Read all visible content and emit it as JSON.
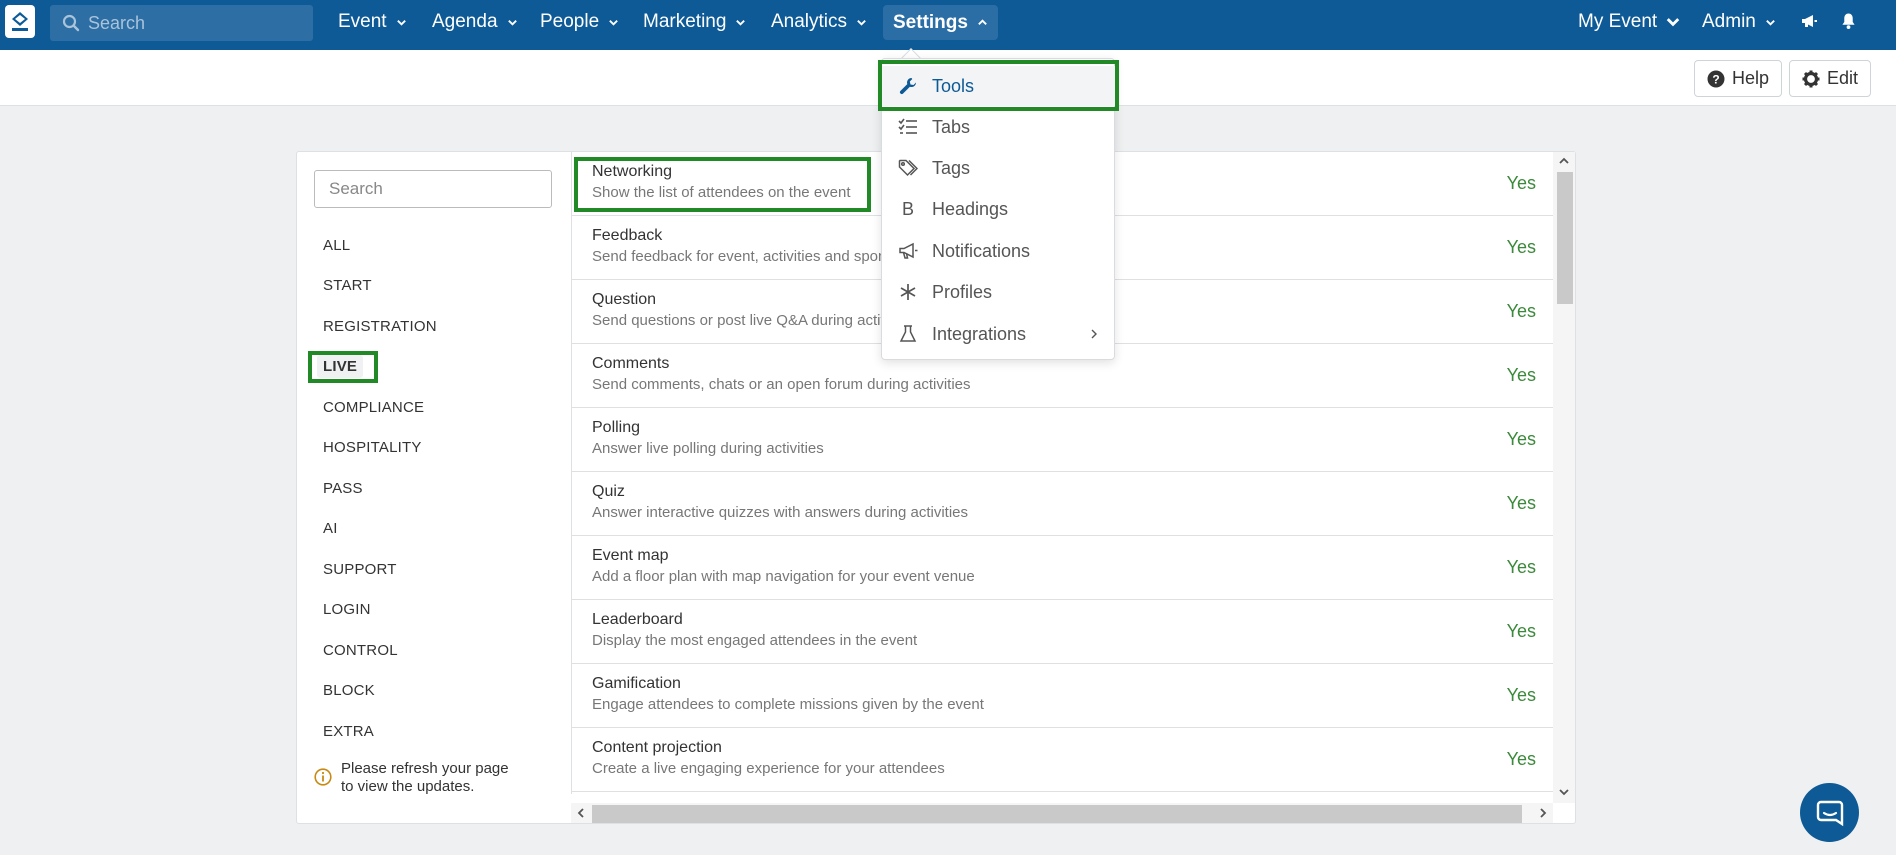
{
  "nav": {
    "search_placeholder": "Search",
    "items": [
      "Event",
      "Agenda",
      "People",
      "Marketing",
      "Analytics",
      "Settings"
    ],
    "right_items": [
      "My Event",
      "Admin"
    ],
    "icons": [
      "megaphone-icon",
      "bell-icon"
    ]
  },
  "header": {
    "help_label": "Help",
    "edit_label": "Edit"
  },
  "sidebar": {
    "search_placeholder": "Search",
    "categories": [
      "ALL",
      "START",
      "REGISTRATION",
      "LIVE",
      "COMPLIANCE",
      "HOSPITALITY",
      "PASS",
      "AI",
      "SUPPORT",
      "LOGIN",
      "CONTROL",
      "BLOCK",
      "EXTRA"
    ],
    "selected": "LIVE",
    "notice": [
      "Please refresh your page",
      "to view the updates."
    ]
  },
  "features": [
    {
      "title": "Networking",
      "desc": "Show the list of attendees on the event",
      "value": "Yes"
    },
    {
      "title": "Feedback",
      "desc": "Send feedback for event, activities and sponsors",
      "value": "Yes"
    },
    {
      "title": "Question",
      "desc": "Send questions or post live Q&A during activities",
      "value": "Yes"
    },
    {
      "title": "Comments",
      "desc": "Send comments, chats or an open forum during activities",
      "value": "Yes"
    },
    {
      "title": "Polling",
      "desc": "Answer live polling during activities",
      "value": "Yes"
    },
    {
      "title": "Quiz",
      "desc": "Answer interactive quizzes with answers during activities",
      "value": "Yes"
    },
    {
      "title": "Event map",
      "desc": "Add a floor plan with map navigation for your event venue",
      "value": "Yes"
    },
    {
      "title": "Leaderboard",
      "desc": "Display the most engaged attendees in the event",
      "value": "Yes"
    },
    {
      "title": "Gamification",
      "desc": "Engage attendees to complete missions given by the event",
      "value": "Yes"
    },
    {
      "title": "Content projection",
      "desc": "Create a live engaging experience for your attendees",
      "value": "Yes"
    }
  ],
  "settings_menu": [
    {
      "label": "Tools",
      "icon": "wrench-icon"
    },
    {
      "label": "Tabs",
      "icon": "list-check-icon"
    },
    {
      "label": "Tags",
      "icon": "tags-icon"
    },
    {
      "label": "Headings",
      "icon": "bold-b-icon"
    },
    {
      "label": "Notifications",
      "icon": "megaphone-icon"
    },
    {
      "label": "Profiles",
      "icon": "asterisk-icon"
    },
    {
      "label": "Integrations",
      "icon": "flask-icon"
    }
  ],
  "colors": {
    "nav": "#0d5a96",
    "highlight": "#218a26",
    "yes": "#3a8a3a"
  }
}
